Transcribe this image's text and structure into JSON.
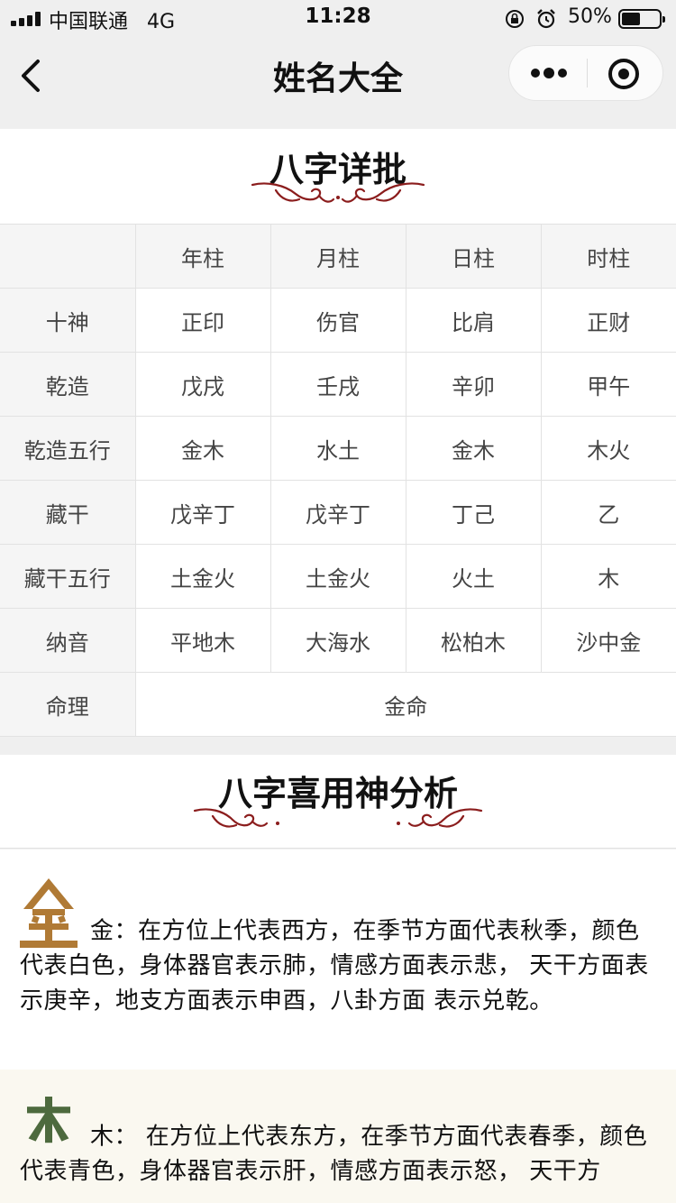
{
  "status_bar": {
    "carrier": "中国联通",
    "network": "4G",
    "time": "11:28",
    "battery_percent": "50%",
    "battery_level": 0.5
  },
  "nav": {
    "title": "姓名大全"
  },
  "bazi": {
    "title": "八字详批",
    "columns": [
      "年柱",
      "月柱",
      "日柱",
      "时柱"
    ],
    "rows": [
      {
        "label": "十神",
        "values": [
          "正印",
          "伤官",
          "比肩",
          "正财"
        ]
      },
      {
        "label": "乾造",
        "values": [
          "戊戌",
          "壬戌",
          "辛卯",
          "甲午"
        ]
      },
      {
        "label": "乾造五行",
        "values": [
          "金木",
          "水土",
          "金木",
          "木火"
        ]
      },
      {
        "label": "藏干",
        "values": [
          "戊辛丁",
          "戊辛丁",
          "丁己",
          "乙"
        ]
      },
      {
        "label": "藏干五行",
        "values": [
          "土金火",
          "土金火",
          "火土",
          "木"
        ]
      },
      {
        "label": "纳音",
        "values": [
          "平地木",
          "大海水",
          "松柏木",
          "沙中金"
        ]
      }
    ],
    "fate_label": "命理",
    "fate_value": "金命"
  },
  "analysis": {
    "title": "八字喜用神分析",
    "elements": [
      {
        "icon": "metal-glyph-icon",
        "icon_color": "#b07a35",
        "text": "金：在方位上代表西方，在季节方面代表秋季，颜色代表白色，身体器官表示肺，情感方面表示悲， 天干方面表示庚辛，地支方面表示申酉，八卦方面 表示兑乾。"
      },
      {
        "icon": "wood-glyph-icon",
        "icon_color": "#4d6a3e",
        "text": "木： 在方位上代表东方，在季节方面代表春季，颜色代表青色，身体器官表示肝，情感方面表示怒， 天干方"
      }
    ]
  },
  "colors": {
    "ornament": "#8b1d1d",
    "background": "#efefef"
  }
}
